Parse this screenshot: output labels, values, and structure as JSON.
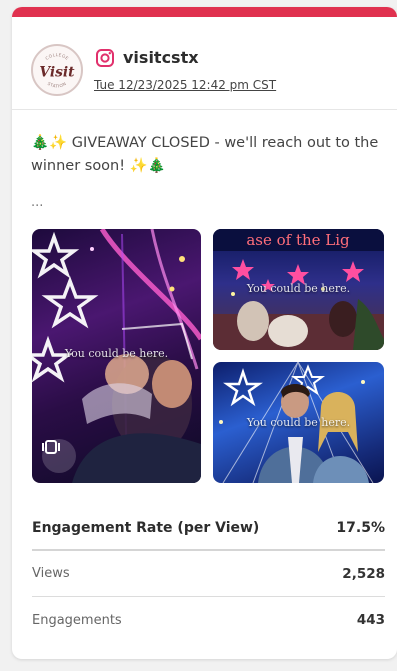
{
  "post": {
    "platform_icon": "instagram-icon",
    "handle": "visitcstx",
    "timestamp": "Tue 12/23/2025 12:42 pm CST",
    "avatar_wordmark": "Visit",
    "avatar_top_text": "COLLEGE",
    "avatar_bottom_text": "STATION",
    "caption": "🎄✨ GIVEAWAY CLOSED - we'll reach out to the winner soon! ✨🎄",
    "more": "...",
    "accent_color": "#e0314f",
    "instagram_color": "#e1306c"
  },
  "media": {
    "watermark": "You could be here.",
    "top_right_sign": "ase of the Lig",
    "carousel_icon": "carousel-icon"
  },
  "metrics": {
    "engagement_rate_label": "Engagement Rate (per View)",
    "engagement_rate_value": "17.5%",
    "views_label": "Views",
    "views_value": "2,528",
    "engagements_label": "Engagements",
    "engagements_value": "443"
  }
}
